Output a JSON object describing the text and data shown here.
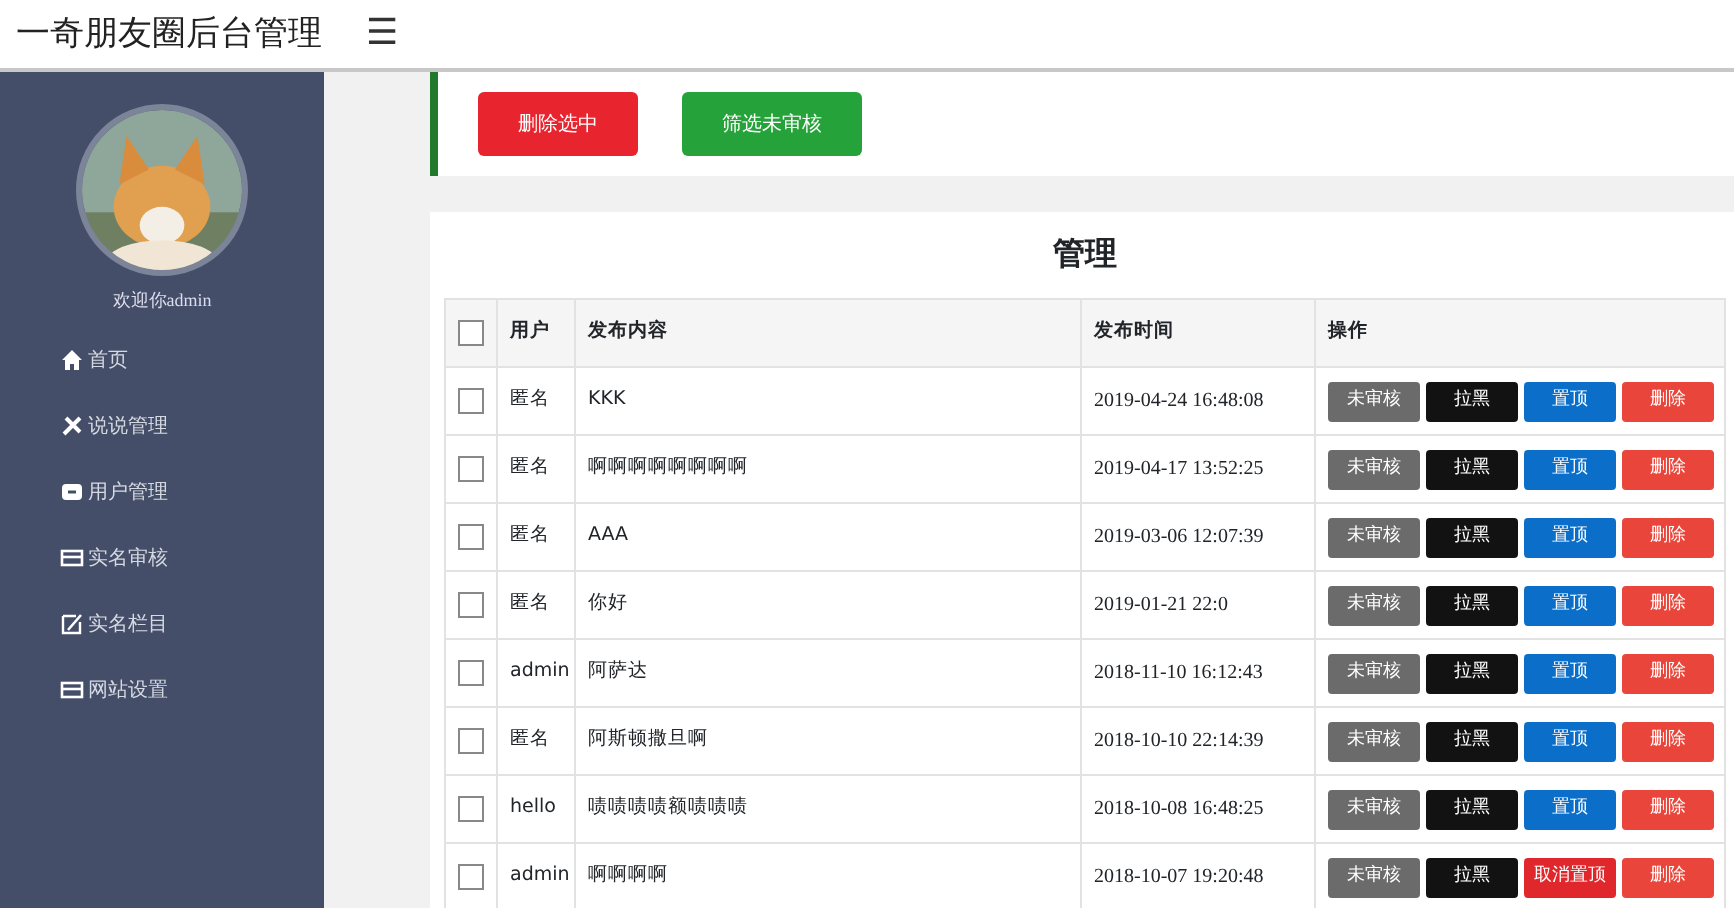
{
  "header": {
    "title": "一奇朋友圈后台管理",
    "menu_toggle": "☰"
  },
  "sidebar": {
    "welcome": "欢迎你admin",
    "items": [
      {
        "label": "首页"
      },
      {
        "label": "说说管理"
      },
      {
        "label": "用户管理"
      },
      {
        "label": "实名审核"
      },
      {
        "label": "实名栏目"
      },
      {
        "label": "网站设置"
      }
    ]
  },
  "toolbar": {
    "buttons": [
      {
        "label": "删除选中",
        "kind": "danger"
      },
      {
        "label": "筛选未审核",
        "kind": "success"
      }
    ]
  },
  "panel": {
    "title": "管理",
    "table": {
      "select_all_checked": false,
      "columns": [
        "用户",
        "发布内容",
        "发布时间",
        "操作"
      ],
      "rows": [
        {
          "checked": false,
          "user": "匿名",
          "content": "KKK",
          "time": "2019-04-24 16:48:08",
          "actions": [
            "未审核",
            "拉黑",
            "置顶",
            "删除"
          ],
          "pinned": false
        },
        {
          "checked": false,
          "user": "匿名",
          "content": "啊啊啊啊啊啊啊啊",
          "time": "2019-04-17 13:52:25",
          "actions": [
            "未审核",
            "拉黑",
            "置顶",
            "删除"
          ],
          "pinned": false
        },
        {
          "checked": false,
          "user": "匿名",
          "content": "AAA",
          "time": "2019-03-06 12:07:39",
          "actions": [
            "未审核",
            "拉黑",
            "置顶",
            "删除"
          ],
          "pinned": false
        },
        {
          "checked": false,
          "user": "匿名",
          "content": "你好",
          "time": "2019-01-21 22:0",
          "actions": [
            "未审核",
            "拉黑",
            "置顶",
            "删除"
          ],
          "pinned": false
        },
        {
          "checked": false,
          "user": "admin",
          "content": "阿萨达",
          "time": "2018-11-10 16:12:43",
          "actions": [
            "未审核",
            "拉黑",
            "置顶",
            "删除"
          ],
          "pinned": false
        },
        {
          "checked": false,
          "user": "匿名",
          "content": "阿斯顿撒旦啊",
          "time": "2018-10-10 22:14:39",
          "actions": [
            "未审核",
            "拉黑",
            "置顶",
            "删除"
          ],
          "pinned": false
        },
        {
          "checked": false,
          "user": "hello",
          "content": "啧啧啧啧额啧啧啧",
          "time": "2018-10-08 16:48:25",
          "actions": [
            "未审核",
            "拉黑",
            "置顶",
            "删除"
          ],
          "pinned": false
        },
        {
          "checked": false,
          "user": "admin",
          "content": "啊啊啊啊",
          "time": "2018-10-07 19:20:48",
          "actions": [
            "未审核",
            "拉黑",
            "取消置顶",
            "删除"
          ],
          "pinned": true
        }
      ]
    }
  }
}
